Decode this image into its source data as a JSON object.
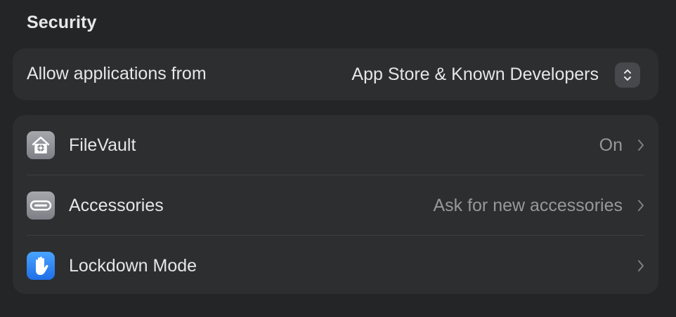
{
  "section": {
    "title": "Security"
  },
  "allow_apps": {
    "label": "Allow applications from",
    "value": "App Store & Known Developers",
    "control_icon": "up-down-chevron-icon"
  },
  "rows": [
    {
      "label": "FileVault",
      "value": "On",
      "icon": "filevault-house-icon",
      "icon_color": "#8f9197"
    },
    {
      "label": "Accessories",
      "value": "Ask for new accessories",
      "icon": "usb-c-port-icon",
      "icon_color": "#8f9197"
    },
    {
      "label": "Lockdown Mode",
      "value": "",
      "icon": "raised-hand-icon",
      "icon_color": "#2f86f5"
    }
  ],
  "colors": {
    "background": "#232527",
    "card": "#2c2e30",
    "primary_text": "#e6e6e7",
    "secondary_text": "#97989b"
  }
}
